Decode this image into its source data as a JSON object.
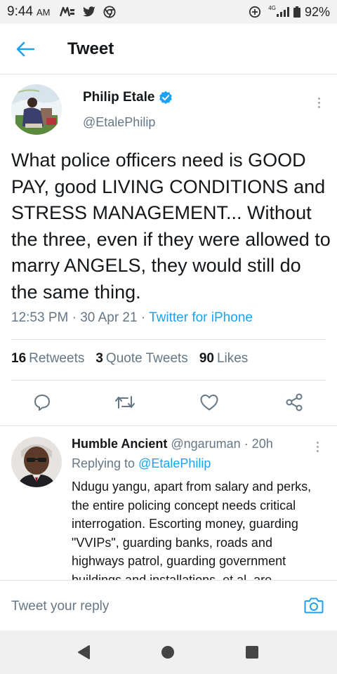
{
  "status_bar": {
    "time": "9:44",
    "ampm": "AM",
    "network": "4G",
    "battery": "92%"
  },
  "header": {
    "title": "Tweet",
    "back_icon": "arrow-left-icon"
  },
  "tweet": {
    "author_name": "Philip Etale",
    "author_handle": "@EtalePhilip",
    "text": "What police officers need is GOOD PAY, good LIVING CONDITIONS and STRESS MANAGEMENT... Without the three, even if they were allowed to marry ANGELS, they would still do the same thing.",
    "time": "12:53 PM",
    "sep1": " · ",
    "date": "30 Apr 21",
    "sep2": " · ",
    "source": "Twitter for iPhone",
    "stats": {
      "retweets_count": "16",
      "retweets_label": "Retweets",
      "quotes_count": "3",
      "quotes_label": "Quote Tweets",
      "likes_count": "90",
      "likes_label": "Likes"
    },
    "actions": [
      "reply-icon",
      "retweet-icon",
      "like-icon",
      "share-icon"
    ]
  },
  "reply": {
    "name": "Humble Ancient",
    "handle": " @ngaruman",
    "time": " · 20h",
    "replying_prefix": "Replying to ",
    "replying_to": "@EtalePhilip",
    "text": "Ndugu yangu, apart from salary and perks, the entire policing concept needs critical interrogation. Escorting money, guarding \"VVIPs\", guarding banks, roads and highways patrol, guarding government buildings and installations, et al, are"
  },
  "compose": {
    "placeholder": "Tweet your reply"
  },
  "colors": {
    "accent": "#1da1f2",
    "text": "#14171a",
    "secondary": "#657786",
    "divider": "#dfe3e6"
  }
}
